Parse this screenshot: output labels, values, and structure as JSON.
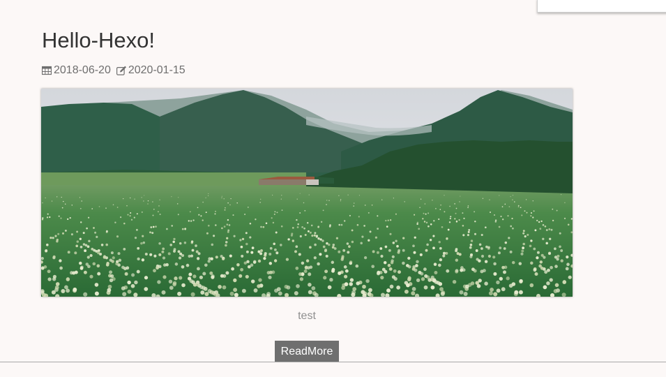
{
  "post": {
    "title": "Hello-Hexo!",
    "date_created": "2018-06-20",
    "date_updated": "2020-01-15",
    "created_icon": "calendar-icon",
    "updated_icon": "edit-icon",
    "image_description": "green potato field with white flowers, forested mountains and low clouds",
    "excerpt": "test",
    "read_more_label": "ReadMore"
  },
  "colors": {
    "background": "#fcf8f7",
    "button": "#6f6f6f",
    "meta_text": "#6e6e6e"
  }
}
